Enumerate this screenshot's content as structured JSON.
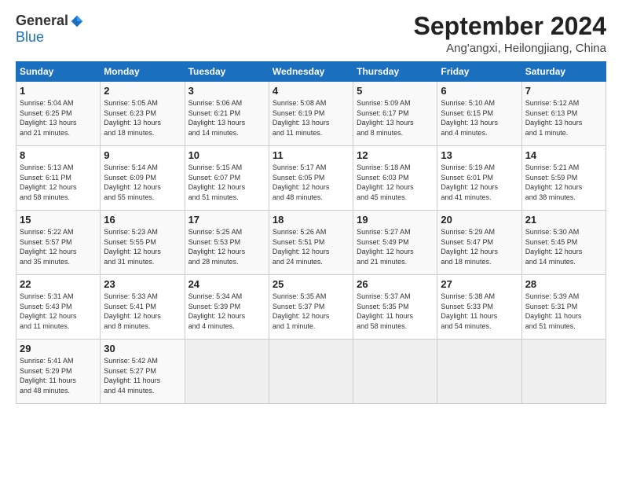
{
  "header": {
    "logo_general": "General",
    "logo_blue": "Blue",
    "month_title": "September 2024",
    "location": "Ang'angxi, Heilongjiang, China"
  },
  "weekdays": [
    "Sunday",
    "Monday",
    "Tuesday",
    "Wednesday",
    "Thursday",
    "Friday",
    "Saturday"
  ],
  "weeks": [
    [
      {
        "day": "1",
        "info": "Sunrise: 5:04 AM\nSunset: 6:25 PM\nDaylight: 13 hours\nand 21 minutes."
      },
      {
        "day": "2",
        "info": "Sunrise: 5:05 AM\nSunset: 6:23 PM\nDaylight: 13 hours\nand 18 minutes."
      },
      {
        "day": "3",
        "info": "Sunrise: 5:06 AM\nSunset: 6:21 PM\nDaylight: 13 hours\nand 14 minutes."
      },
      {
        "day": "4",
        "info": "Sunrise: 5:08 AM\nSunset: 6:19 PM\nDaylight: 13 hours\nand 11 minutes."
      },
      {
        "day": "5",
        "info": "Sunrise: 5:09 AM\nSunset: 6:17 PM\nDaylight: 13 hours\nand 8 minutes."
      },
      {
        "day": "6",
        "info": "Sunrise: 5:10 AM\nSunset: 6:15 PM\nDaylight: 13 hours\nand 4 minutes."
      },
      {
        "day": "7",
        "info": "Sunrise: 5:12 AM\nSunset: 6:13 PM\nDaylight: 13 hours\nand 1 minute."
      }
    ],
    [
      {
        "day": "8",
        "info": "Sunrise: 5:13 AM\nSunset: 6:11 PM\nDaylight: 12 hours\nand 58 minutes."
      },
      {
        "day": "9",
        "info": "Sunrise: 5:14 AM\nSunset: 6:09 PM\nDaylight: 12 hours\nand 55 minutes."
      },
      {
        "day": "10",
        "info": "Sunrise: 5:15 AM\nSunset: 6:07 PM\nDaylight: 12 hours\nand 51 minutes."
      },
      {
        "day": "11",
        "info": "Sunrise: 5:17 AM\nSunset: 6:05 PM\nDaylight: 12 hours\nand 48 minutes."
      },
      {
        "day": "12",
        "info": "Sunrise: 5:18 AM\nSunset: 6:03 PM\nDaylight: 12 hours\nand 45 minutes."
      },
      {
        "day": "13",
        "info": "Sunrise: 5:19 AM\nSunset: 6:01 PM\nDaylight: 12 hours\nand 41 minutes."
      },
      {
        "day": "14",
        "info": "Sunrise: 5:21 AM\nSunset: 5:59 PM\nDaylight: 12 hours\nand 38 minutes."
      }
    ],
    [
      {
        "day": "15",
        "info": "Sunrise: 5:22 AM\nSunset: 5:57 PM\nDaylight: 12 hours\nand 35 minutes."
      },
      {
        "day": "16",
        "info": "Sunrise: 5:23 AM\nSunset: 5:55 PM\nDaylight: 12 hours\nand 31 minutes."
      },
      {
        "day": "17",
        "info": "Sunrise: 5:25 AM\nSunset: 5:53 PM\nDaylight: 12 hours\nand 28 minutes."
      },
      {
        "day": "18",
        "info": "Sunrise: 5:26 AM\nSunset: 5:51 PM\nDaylight: 12 hours\nand 24 minutes."
      },
      {
        "day": "19",
        "info": "Sunrise: 5:27 AM\nSunset: 5:49 PM\nDaylight: 12 hours\nand 21 minutes."
      },
      {
        "day": "20",
        "info": "Sunrise: 5:29 AM\nSunset: 5:47 PM\nDaylight: 12 hours\nand 18 minutes."
      },
      {
        "day": "21",
        "info": "Sunrise: 5:30 AM\nSunset: 5:45 PM\nDaylight: 12 hours\nand 14 minutes."
      }
    ],
    [
      {
        "day": "22",
        "info": "Sunrise: 5:31 AM\nSunset: 5:43 PM\nDaylight: 12 hours\nand 11 minutes."
      },
      {
        "day": "23",
        "info": "Sunrise: 5:33 AM\nSunset: 5:41 PM\nDaylight: 12 hours\nand 8 minutes."
      },
      {
        "day": "24",
        "info": "Sunrise: 5:34 AM\nSunset: 5:39 PM\nDaylight: 12 hours\nand 4 minutes."
      },
      {
        "day": "25",
        "info": "Sunrise: 5:35 AM\nSunset: 5:37 PM\nDaylight: 12 hours\nand 1 minute."
      },
      {
        "day": "26",
        "info": "Sunrise: 5:37 AM\nSunset: 5:35 PM\nDaylight: 11 hours\nand 58 minutes."
      },
      {
        "day": "27",
        "info": "Sunrise: 5:38 AM\nSunset: 5:33 PM\nDaylight: 11 hours\nand 54 minutes."
      },
      {
        "day": "28",
        "info": "Sunrise: 5:39 AM\nSunset: 5:31 PM\nDaylight: 11 hours\nand 51 minutes."
      }
    ],
    [
      {
        "day": "29",
        "info": "Sunrise: 5:41 AM\nSunset: 5:29 PM\nDaylight: 11 hours\nand 48 minutes."
      },
      {
        "day": "30",
        "info": "Sunrise: 5:42 AM\nSunset: 5:27 PM\nDaylight: 11 hours\nand 44 minutes."
      },
      {
        "day": "",
        "info": ""
      },
      {
        "day": "",
        "info": ""
      },
      {
        "day": "",
        "info": ""
      },
      {
        "day": "",
        "info": ""
      },
      {
        "day": "",
        "info": ""
      }
    ]
  ]
}
